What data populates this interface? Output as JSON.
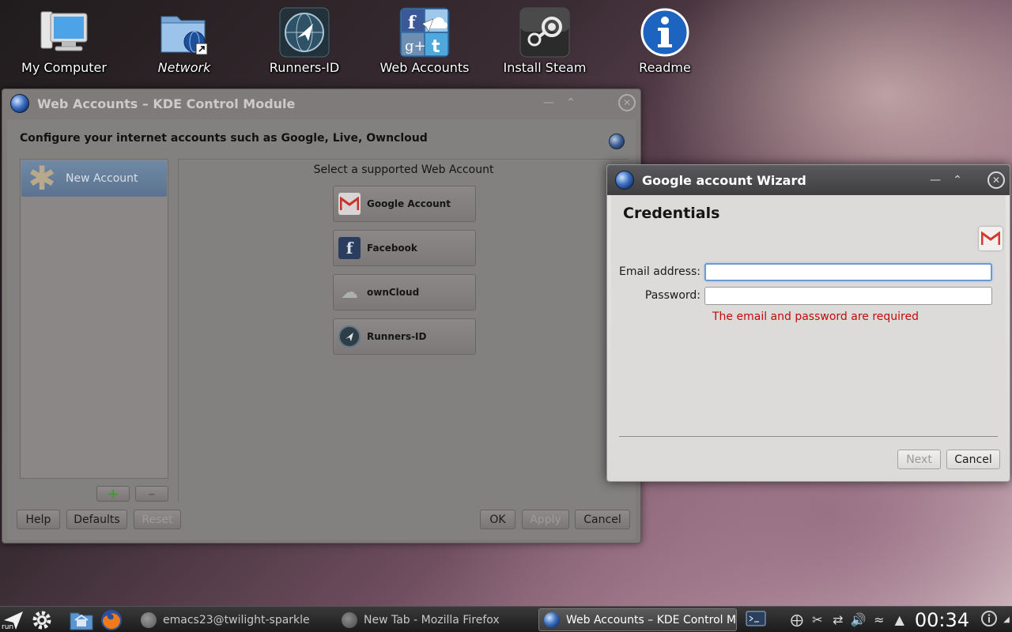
{
  "desktop": {
    "icons": [
      {
        "label": "My Computer",
        "icon": "computer-icon"
      },
      {
        "label": "Network",
        "icon": "network-folder-icon"
      },
      {
        "label": "Runners-ID",
        "icon": "runners-id-icon"
      },
      {
        "label": "Web Accounts",
        "icon": "web-accounts-icon"
      },
      {
        "label": "Install Steam",
        "icon": "steam-icon"
      },
      {
        "label": "Readme",
        "icon": "info-icon"
      }
    ]
  },
  "kcm": {
    "title": "Web Accounts – KDE Control Module",
    "header": "Configure your internet accounts such as Google, Live, Owncloud",
    "accounts": [
      {
        "label": "New Account"
      }
    ],
    "add_label": "+",
    "remove_label": "–",
    "prompt": "Select a supported Web Account",
    "providers": [
      {
        "label": "Google Account",
        "icon": "gmail-icon"
      },
      {
        "label": "Facebook",
        "icon": "facebook-icon"
      },
      {
        "label": "ownCloud",
        "icon": "owncloud-icon"
      },
      {
        "label": "Runners-ID",
        "icon": "runners-id-icon"
      }
    ],
    "buttons": {
      "help": "Help",
      "defaults": "Defaults",
      "reset": "Reset",
      "ok": "OK",
      "apply": "Apply",
      "cancel": "Cancel"
    }
  },
  "wizard": {
    "title": "Google account Wizard",
    "heading": "Credentials",
    "email_label": "Email address:",
    "email_value": "",
    "password_label": "Password:",
    "password_value": "",
    "error": "The email and password are required",
    "next": "Next",
    "cancel": "Cancel"
  },
  "taskbar": {
    "run_label": "run",
    "tasks": [
      {
        "label": "emacs23@twilight-sparkle",
        "active": false
      },
      {
        "label": "New Tab - Mozilla Firefox",
        "active": false
      },
      {
        "label": "Web Accounts – KDE Control Mo",
        "active": true
      }
    ],
    "clock": "00:34"
  },
  "colors": {
    "error": "#c20b0b",
    "selection": "#5b7390",
    "focus": "#6b9bd1"
  }
}
